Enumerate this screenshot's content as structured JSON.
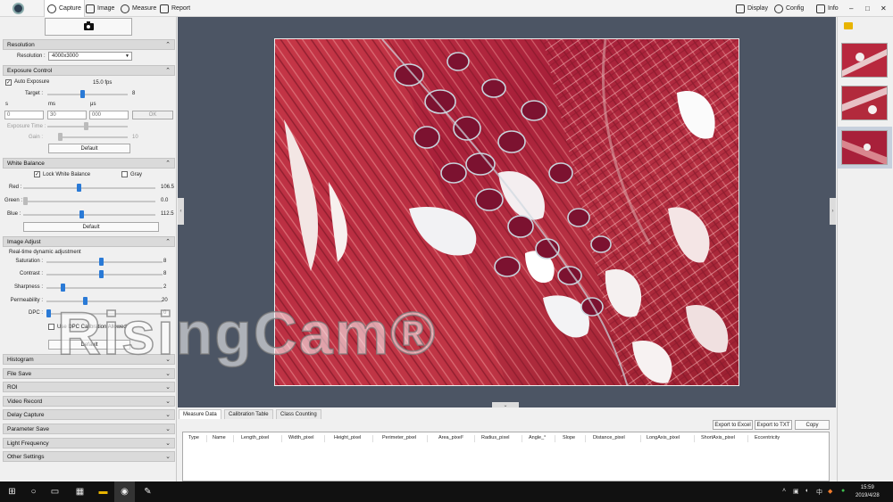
{
  "menubar": {
    "tabs": [
      {
        "label": "Capture",
        "icon": "aperture-icon"
      },
      {
        "label": "Image",
        "icon": "image-icon"
      },
      {
        "label": "Measure",
        "icon": "ruler-icon"
      },
      {
        "label": "Report",
        "icon": "report-icon"
      }
    ],
    "right": [
      {
        "label": "Display",
        "icon": "monitor-icon"
      },
      {
        "label": "Config",
        "icon": "gear-icon"
      },
      {
        "label": "Info",
        "icon": "info-icon"
      }
    ],
    "window_controls": [
      "–",
      "□",
      "✕"
    ]
  },
  "capture": {
    "resolution_label": "Resolution",
    "resolution_field": "Resolution :",
    "resolution_value": "4000x3000"
  },
  "exposure": {
    "title": "Exposure Control",
    "auto_label": "Auto Exposure",
    "auto_checked": true,
    "fps": "15.0 fps",
    "target_label": "Target :",
    "target_value": "8",
    "target_fraction": 0.43,
    "unit_s": "s",
    "unit_ms": "ms",
    "unit_us": "μs",
    "spin_s": "0",
    "spin_ms": "30",
    "spin_us": "000",
    "ok": "OK",
    "time_label": "Exposure Time :",
    "gain_label": "Gain :",
    "gain_value": "10",
    "gain_fraction": 0.0,
    "default": "Default"
  },
  "white_balance": {
    "title": "White Balance",
    "lock_label": "Lock White Balance",
    "lock_checked": true,
    "gray_label": "Gray",
    "red_label": "Red :",
    "red_value": "106.5",
    "red_fraction": 0.42,
    "green_label": "Green :",
    "green_value": "0.0",
    "green_fraction": 0.0,
    "blue_label": "Blue :",
    "blue_value": "112.5",
    "blue_fraction": 0.44,
    "default": "Default"
  },
  "image_adjust": {
    "title": "Image Adjust",
    "rt_label": "Real-time dynamic adjustment",
    "saturation_label": "Saturation :",
    "saturation_value": "8",
    "saturation_fraction": 0.47,
    "contrast_label": "Contrast :",
    "contrast_value": "8",
    "contrast_fraction": 0.47,
    "sharpness_label": "Sharpness :",
    "sharpness_value": "2",
    "sharpness_fraction": 0.13,
    "permeability_label": "Permeability :",
    "permeability_value": "20",
    "permeability_fraction": 0.33,
    "dpc_label": "DPC :",
    "dpc_value": "0",
    "dpc_fraction": 0.0,
    "calib_label": "Use DPC Calibration Allowed",
    "default": "Default"
  },
  "collapsed_sections": [
    "Histogram",
    "File Save",
    "ROI",
    "Video Record",
    "Delay Capture",
    "Parameter Save",
    "Light Frequency",
    "Other Settings"
  ],
  "bottom": {
    "tabs": [
      "Measure Data",
      "Calibration Table",
      "Class Counting"
    ],
    "buttons": [
      "Export to Excel",
      "Export to TXT",
      "Copy"
    ],
    "columns": [
      "Type",
      "Name",
      "Length_pixel",
      "Width_pixel",
      "Height_pixel",
      "Perimeter_pixel",
      "Area_pixel²",
      "Radius_pixel",
      "Angle_°",
      "Slope",
      "Distance_pixel",
      "LongAxis_pixel",
      "ShortAxis_pixel",
      "Eccentricity"
    ]
  },
  "watermark": "RisingCam®",
  "taskbar": {
    "time": "15:59",
    "date": "2019/4/28",
    "ime": "中",
    "tray_icons": [
      "network-icon",
      "volume-icon"
    ]
  },
  "colors": {
    "accent": "#2a7ad6",
    "stage": "#4c5564",
    "tissue_red": "#b0283a"
  }
}
